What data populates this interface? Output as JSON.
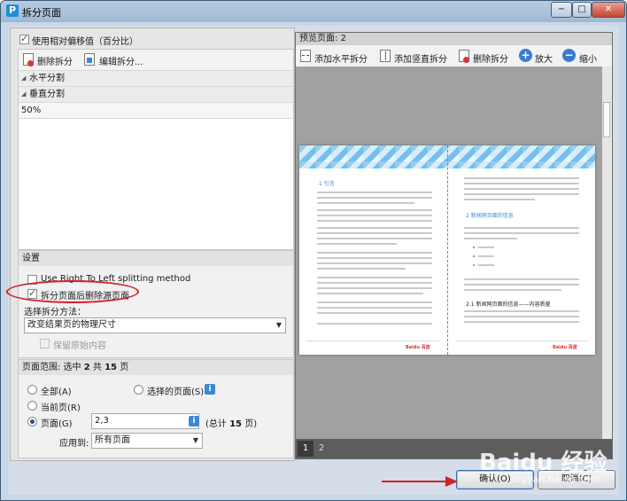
{
  "window": {
    "title": "拆分页面",
    "app_icon": "P"
  },
  "title_buttons": {
    "minimize": "−",
    "maximize": "□",
    "close": "✕"
  },
  "left": {
    "use_relative_offset": {
      "label": "使用相对偏移值（百分比）",
      "checked": true
    },
    "tree_toolbar": {
      "delete_label": "删除拆分",
      "edit_label": "编辑拆分..."
    },
    "tree_items": [
      {
        "label": "水平分割"
      },
      {
        "label": "垂直分割"
      },
      {
        "label": "50%"
      }
    ],
    "settings": {
      "header": "设置",
      "rtl": {
        "label": "Use Right To Left splitting method",
        "checked": false
      },
      "delete_source": {
        "label": "拆分页面后删除源页面",
        "checked": true
      },
      "method_label": "选择拆分方法：",
      "method_value": "改变结果页的物理尺寸",
      "keep_content": {
        "label": "保留原始内容",
        "checked": false
      }
    },
    "page_range": {
      "header_prefix": "页面范围: 选中",
      "selected": "2",
      "header_mid": "共",
      "total": "15",
      "header_suffix": "页",
      "all_label": "全部(A)",
      "selected_pages_label": "选择的页面(S)",
      "current_label": "当前页(R)",
      "pages_label": "页面(G)",
      "pages_value": "2,3",
      "total_prefix": "(总计",
      "total_value": "15",
      "total_suffix": "页)",
      "apply_label": "应用到:",
      "apply_value": "所有页面"
    }
  },
  "right": {
    "preview_label": "预览页面: 2",
    "toolbar": {
      "add_h": "添加水平拆分",
      "add_v": "添加竖直拆分",
      "delete": "删除拆分",
      "zoom_in": "放大",
      "zoom_out": "缩小"
    },
    "doc": {
      "left_heading": "1 引言",
      "right_heading": "2 新闻网页面的信息",
      "sub_heading": "2.1 新闻网页面的信息——内容质量",
      "logo": "Baidu 百度"
    },
    "pages": [
      "1",
      "2"
    ]
  },
  "buttons": {
    "ok": "确认(O)",
    "cancel": "取消(C)"
  },
  "watermark": {
    "main": "Baidu 经验",
    "sub": "jingyan.baidu.com"
  },
  "colors": {
    "annotation": "#d4202a",
    "accent": "#3a8ad8"
  }
}
